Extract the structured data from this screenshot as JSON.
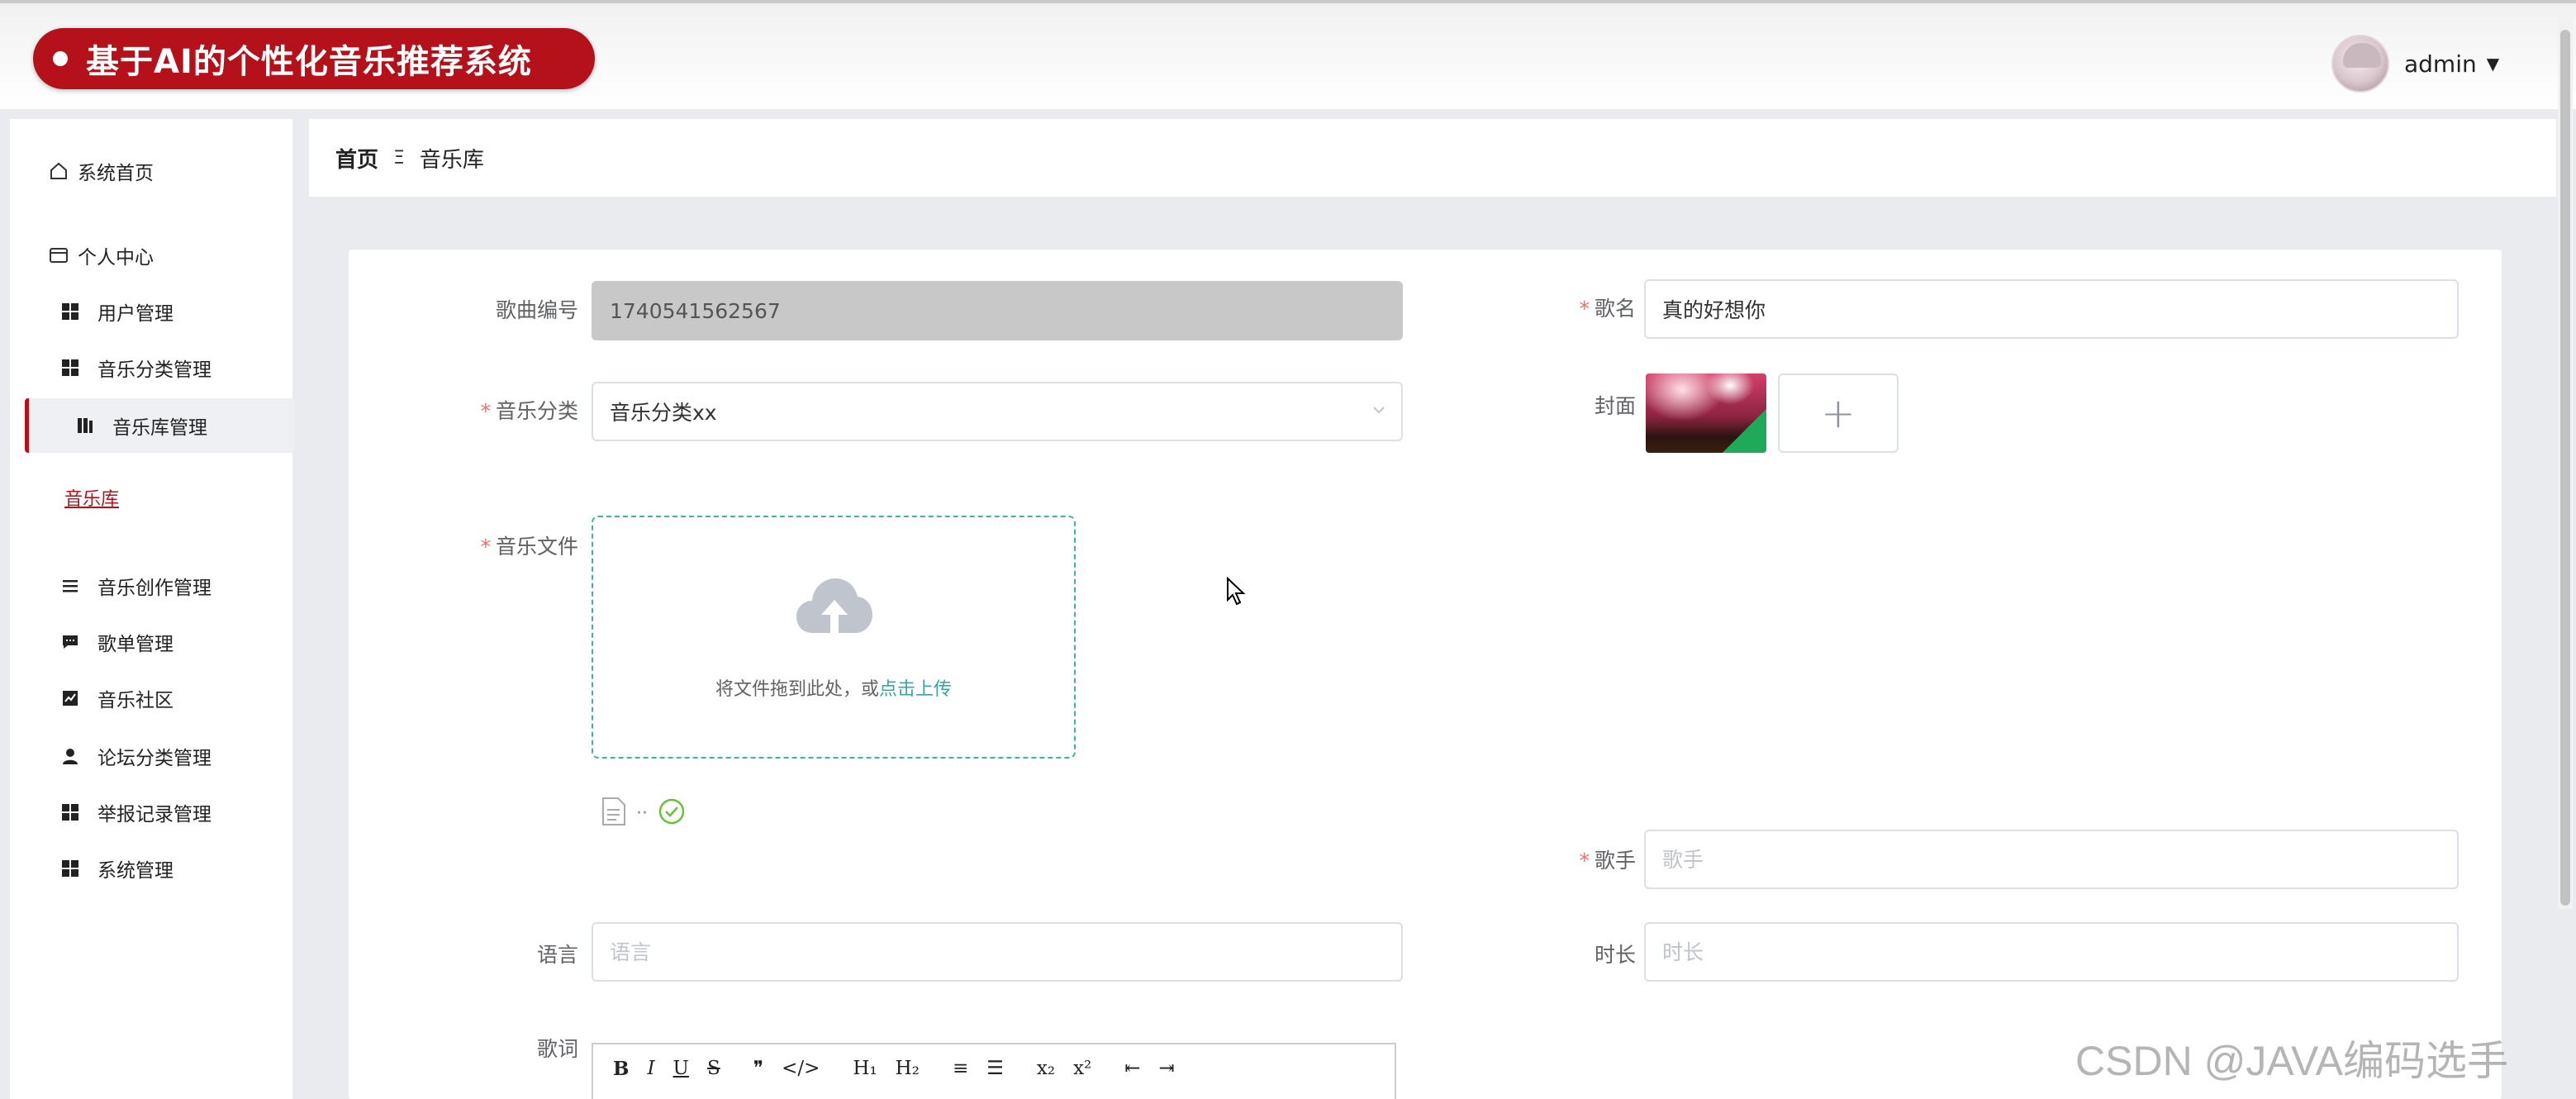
{
  "header": {
    "title": "基于AI的个性化音乐推荐系统",
    "user_name": "admin",
    "caret": "▼"
  },
  "sidebar": {
    "home": "系统首页",
    "personal": "个人中心",
    "items": [
      {
        "label": "用户管理"
      },
      {
        "label": "音乐分类管理"
      },
      {
        "label": "音乐库管理"
      },
      {
        "label": "音乐创作管理"
      },
      {
        "label": "歌单管理"
      },
      {
        "label": "音乐社区"
      },
      {
        "label": "论坛分类管理"
      },
      {
        "label": "举报记录管理"
      },
      {
        "label": "系统管理"
      }
    ],
    "sub_link": "音乐库"
  },
  "breadcrumb": {
    "home": "首页",
    "sep": "Ξ",
    "current": "音乐库"
  },
  "form": {
    "song_no_label": "歌曲编号",
    "song_no_value": "1740541562567",
    "song_name_label": "歌名",
    "song_name_value": "真的好想你",
    "category_label": "音乐分类",
    "category_value": "音乐分类xx",
    "cover_label": "封面",
    "cover_add": "+",
    "file_label": "音乐文件",
    "upload_text": "将文件拖到此处，或",
    "upload_link": "点击上传",
    "file_dots": "··",
    "singer_label": "歌手",
    "singer_placeholder": "歌手",
    "language_label": "语言",
    "language_placeholder": "语言",
    "duration_label": "时长",
    "duration_placeholder": "时长",
    "lyrics_label": "歌词",
    "required_mark": "*"
  },
  "editor_toolbar": [
    "B",
    "I",
    "U",
    "S",
    "❞",
    "</>",
    "H₁",
    "H₂",
    "≡",
    "☰",
    "x₂",
    "x²",
    "⇤",
    "⇥"
  ],
  "watermark": "CSDN @JAVA编码选手",
  "colors": {
    "brand_red": "#b5111b",
    "upload_teal": "#36b5a8",
    "required_red": "#f56c6c"
  }
}
